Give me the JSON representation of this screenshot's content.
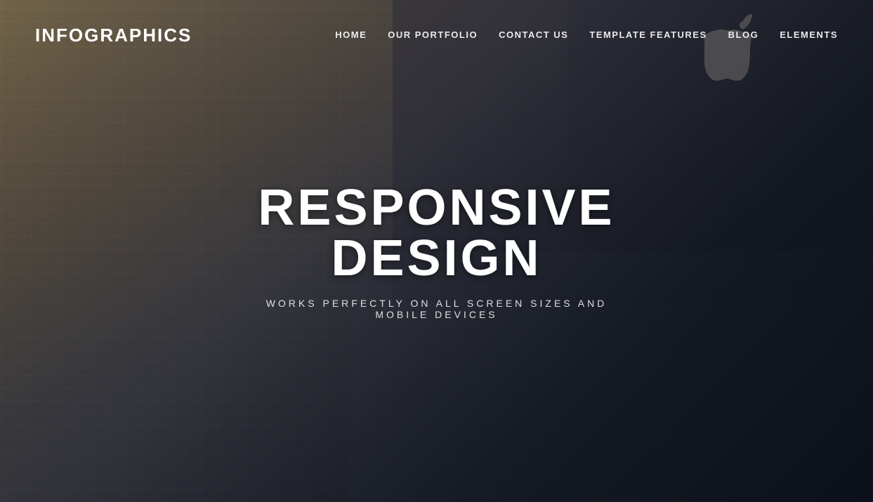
{
  "brand": {
    "name": "INFOGRAPHICS"
  },
  "nav": {
    "items": [
      {
        "label": "HOME",
        "id": "home"
      },
      {
        "label": "OUR PORTFOLIO",
        "id": "portfolio"
      },
      {
        "label": "CONTACT US",
        "id": "contact"
      },
      {
        "label": "TEMPLATE FEATURES",
        "id": "features"
      },
      {
        "label": "BLOG",
        "id": "blog"
      },
      {
        "label": "ELEMENTS",
        "id": "elements"
      }
    ]
  },
  "hero": {
    "title": "RESPONSIVE DESIGN",
    "subtitle": "WORKS PERFECTLY ON ALL SCREEN  SIZES AND MOBILE DEVICES"
  }
}
